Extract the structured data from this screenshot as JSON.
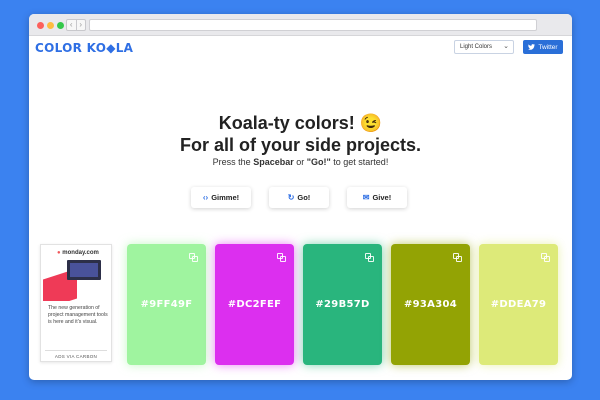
{
  "header": {
    "logo": "COLOR KO◆LA",
    "mode_select": "Light Colors",
    "twitter_label": "Twitter"
  },
  "hero": {
    "line1": "Koala-ty colors! 😉",
    "line2": "For all of your side projects.",
    "sub_prefix": "Press the ",
    "sub_spacebar": "Spacebar",
    "sub_or": " or ",
    "sub_go": "\"Go!\"",
    "sub_suffix": " to get started!"
  },
  "actions": {
    "gimme": "Gimme!",
    "go": "Go!",
    "give": "Give!"
  },
  "ad": {
    "brand": "monday",
    "brand_suffix": ".com",
    "text": "The new generation of project management tools is here and it's visual.",
    "ads_via": "ADS VIA CARBON"
  },
  "palette": [
    {
      "hex": "#9FF49F",
      "color": "#9ff49f"
    },
    {
      "hex": "#DC2FEF",
      "color": "#dc2fef"
    },
    {
      "hex": "#29B57D",
      "color": "#29b57d"
    },
    {
      "hex": "#93A304",
      "color": "#93a304"
    },
    {
      "hex": "#DDEA79",
      "color": "#ddea79"
    }
  ]
}
